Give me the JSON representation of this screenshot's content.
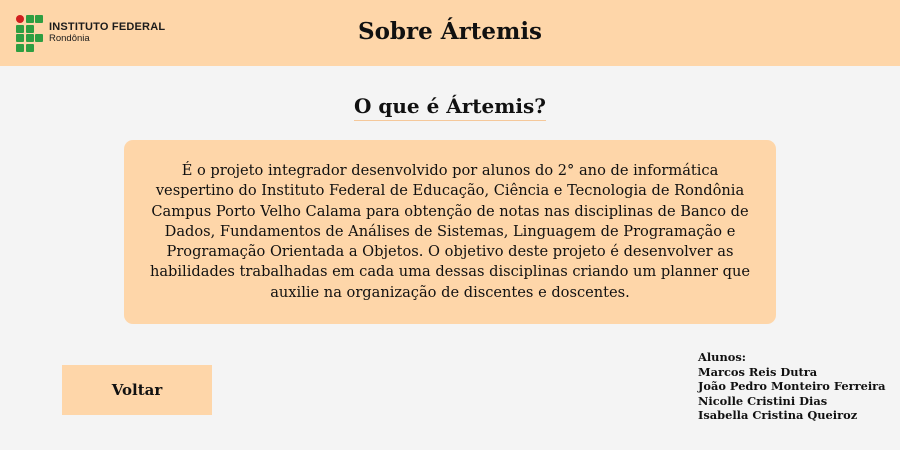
{
  "header": {
    "logo": {
      "name": "INSTITUTO FEDERAL",
      "campus": "Rondônia"
    },
    "title": "Sobre Ártemis"
  },
  "main": {
    "heading": "O que é Ártemis?",
    "description": "É o projeto integrador desenvolvido por alunos do 2° ano de informática vespertino do Instituto Federal de Educação, Ciência e Tecnologia de Rondônia Campus Porto Velho Calama para obtenção de notas nas disciplinas de Banco de Dados, Fundamentos de Análises de Sistemas, Linguagem de Programação e Programação Orientada a Objetos. O objetivo deste projeto é desenvolver as habilidades trabalhadas em cada uma dessas disciplinas criando um planner que auxilie na organização de discentes e doscentes."
  },
  "actions": {
    "back_label": "Voltar"
  },
  "students": {
    "label": "Alunos:",
    "names": [
      "Marcos Reis Dutra",
      "João Pedro Monteiro Ferreira",
      "Nicolle Cristini Dias",
      "Isabella Cristina Queiroz"
    ]
  },
  "colors": {
    "accent": "#fed6a9",
    "background": "#f4f4f4",
    "logo_red": "#d11e1e",
    "logo_green": "#2f9e41"
  },
  "icons": {
    "logo": "if-logo-icon"
  }
}
